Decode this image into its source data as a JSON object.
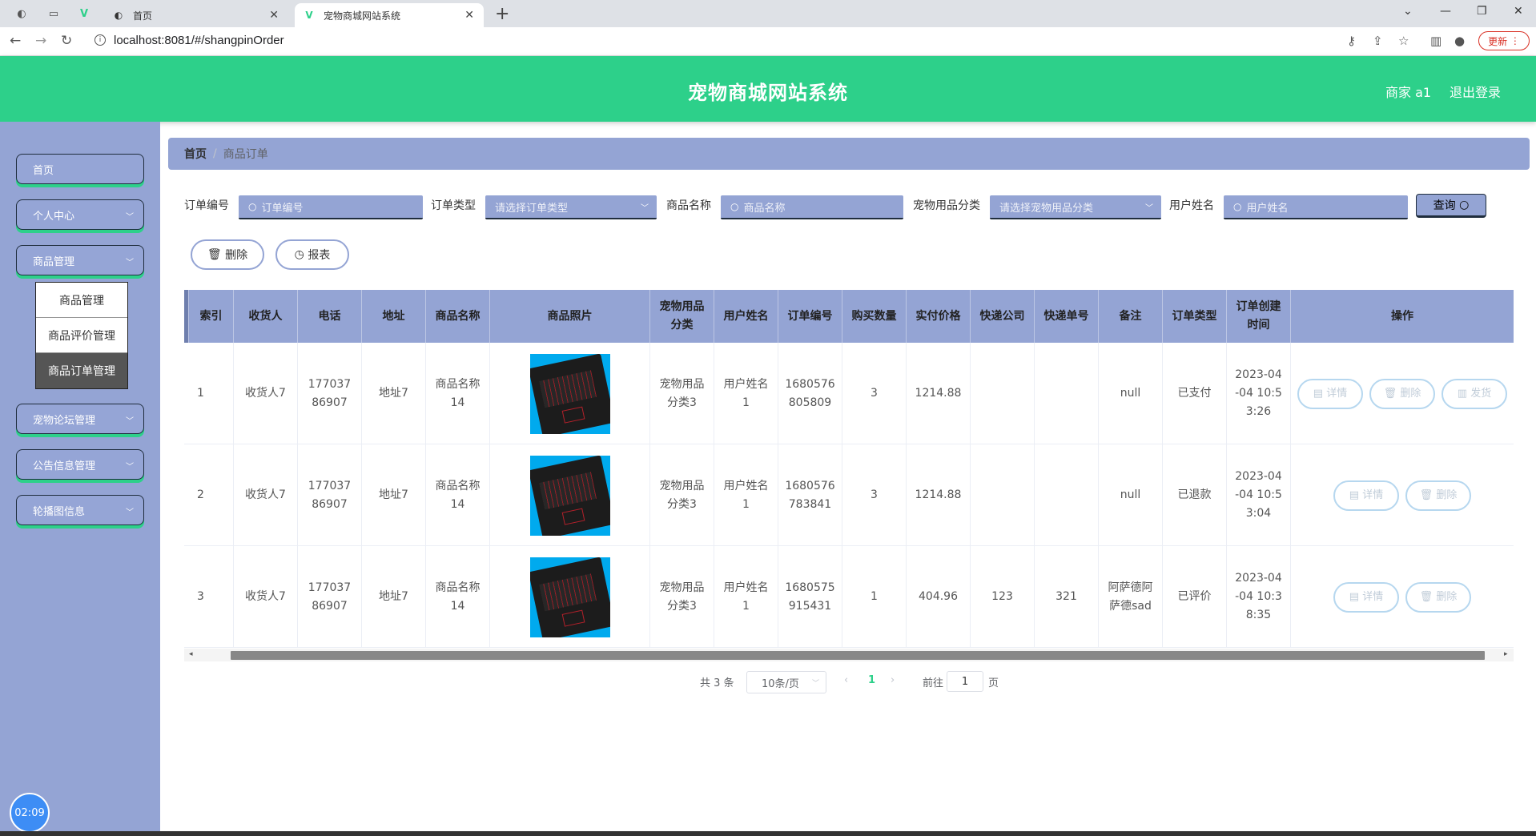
{
  "browser": {
    "tabs": [
      {
        "title": "首页"
      },
      {
        "title": "宠物商城网站系统"
      }
    ],
    "url": "localhost:8081/#/shangpinOrder",
    "update_label": "更新"
  },
  "header": {
    "title": "宠物商城网站系统",
    "user": "商家 a1",
    "logout": "退出登录"
  },
  "sidebar": {
    "items": [
      {
        "label": "首页"
      },
      {
        "label": "个人中心"
      },
      {
        "label": "商品管理"
      },
      {
        "label": "宠物论坛管理"
      },
      {
        "label": "公告信息管理"
      },
      {
        "label": "轮播图信息"
      }
    ],
    "submenu": [
      {
        "label": "商品管理"
      },
      {
        "label": "商品评价管理"
      },
      {
        "label": "商品订单管理"
      }
    ],
    "clock": "02:09"
  },
  "breadcrumb": {
    "home": "首页",
    "current": "商品订单"
  },
  "filters": [
    {
      "label": "订单编号",
      "placeholder": "订单编号"
    },
    {
      "label": "订单类型",
      "placeholder": "请选择订单类型"
    },
    {
      "label": "商品名称",
      "placeholder": "商品名称"
    },
    {
      "label": "宠物用品分类",
      "placeholder": "请选择宠物用品分类"
    },
    {
      "label": "用户姓名",
      "placeholder": "用户姓名"
    }
  ],
  "query_label": "查询",
  "actions": {
    "delete": "删除",
    "report": "报表"
  },
  "table": {
    "headers": [
      "索引",
      "收货人",
      "电话",
      "地址",
      "商品名称",
      "商品照片",
      "宠物用品分类",
      "用户姓名",
      "订单编号",
      "购买数量",
      "实付价格",
      "快递公司",
      "快递单号",
      "备注",
      "订单类型",
      "订单创建时间",
      "操作"
    ],
    "rows": [
      {
        "index": "1",
        "receiver": "收货人7",
        "phone": "17703786907",
        "address": "地址7",
        "product": "商品名称14",
        "category": "宠物用品分类3",
        "user": "用户姓名1",
        "order_no": "1680576805809",
        "qty": "3",
        "price": "1214.88",
        "courier": "",
        "tracking": "",
        "note": "null",
        "type": "已支付",
        "created": "2023-04-04 10:53:26",
        "ops": [
          "详情",
          "删除",
          "发货"
        ]
      },
      {
        "index": "2",
        "receiver": "收货人7",
        "phone": "17703786907",
        "address": "地址7",
        "product": "商品名称14",
        "category": "宠物用品分类3",
        "user": "用户姓名1",
        "order_no": "1680576783841",
        "qty": "3",
        "price": "1214.88",
        "courier": "",
        "tracking": "",
        "note": "null",
        "type": "已退款",
        "created": "2023-04-04 10:53:04",
        "ops": [
          "详情",
          "删除"
        ]
      },
      {
        "index": "3",
        "receiver": "收货人7",
        "phone": "17703786907",
        "address": "地址7",
        "product": "商品名称14",
        "category": "宠物用品分类3",
        "user": "用户姓名1",
        "order_no": "1680575915431",
        "qty": "1",
        "price": "404.96",
        "courier": "123",
        "tracking": "321",
        "note": "阿萨德阿萨德sad",
        "type": "已评价",
        "created": "2023-04-04 10:38:35",
        "ops": [
          "详情",
          "删除"
        ]
      }
    ]
  },
  "pagination": {
    "total": "共 3 条",
    "page_size": "10条/页",
    "current_page": "1",
    "goto_label": "前往",
    "goto_value": "1",
    "page_suffix": "页"
  },
  "colors": {
    "header": "#2dd08a",
    "sidebar": "#94a4d4",
    "accent": "#94a4d4"
  },
  "icons": {
    "search": "search-icon",
    "delete": "trash-icon",
    "report": "clock-icon",
    "detail": "document-icon",
    "ship": "book-icon"
  }
}
